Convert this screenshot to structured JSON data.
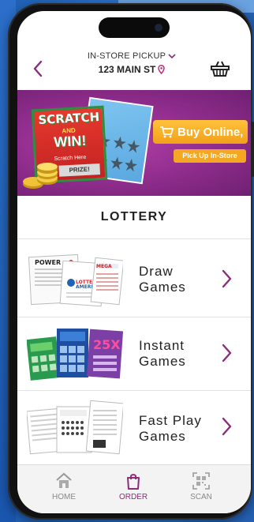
{
  "header": {
    "pickup_mode": "IN-STORE PICKUP",
    "address": "123 MAIN ST"
  },
  "banner": {
    "scratch_title": "SCRATCH",
    "scratch_and": "AND",
    "scratch_win": "WIN!",
    "scratch_here": "Scratch Here",
    "prize": "PRIZE!",
    "buy_online": "Buy Online,",
    "pickup_instore": "Pick Up In-Store"
  },
  "section": {
    "title": "LOTTERY"
  },
  "games": [
    {
      "line1": "Draw",
      "line2": "Games",
      "icon": "draw-games-tickets"
    },
    {
      "line1": "Instant",
      "line2": "Games",
      "icon": "instant-games-tickets"
    },
    {
      "line1": "Fast Play",
      "line2": "Games",
      "icon": "fast-play-tickets"
    }
  ],
  "nav": {
    "items": [
      {
        "label": "HOME",
        "icon": "home-icon",
        "active": false
      },
      {
        "label": "ORDER",
        "icon": "shopping-bag-icon",
        "active": true
      },
      {
        "label": "SCAN",
        "icon": "qr-scan-icon",
        "active": false
      }
    ]
  },
  "colors": {
    "accent": "#8b2d7a",
    "banner": "#9b339a",
    "button_orange": "#f4a722",
    "background": "#2a6ec6"
  }
}
